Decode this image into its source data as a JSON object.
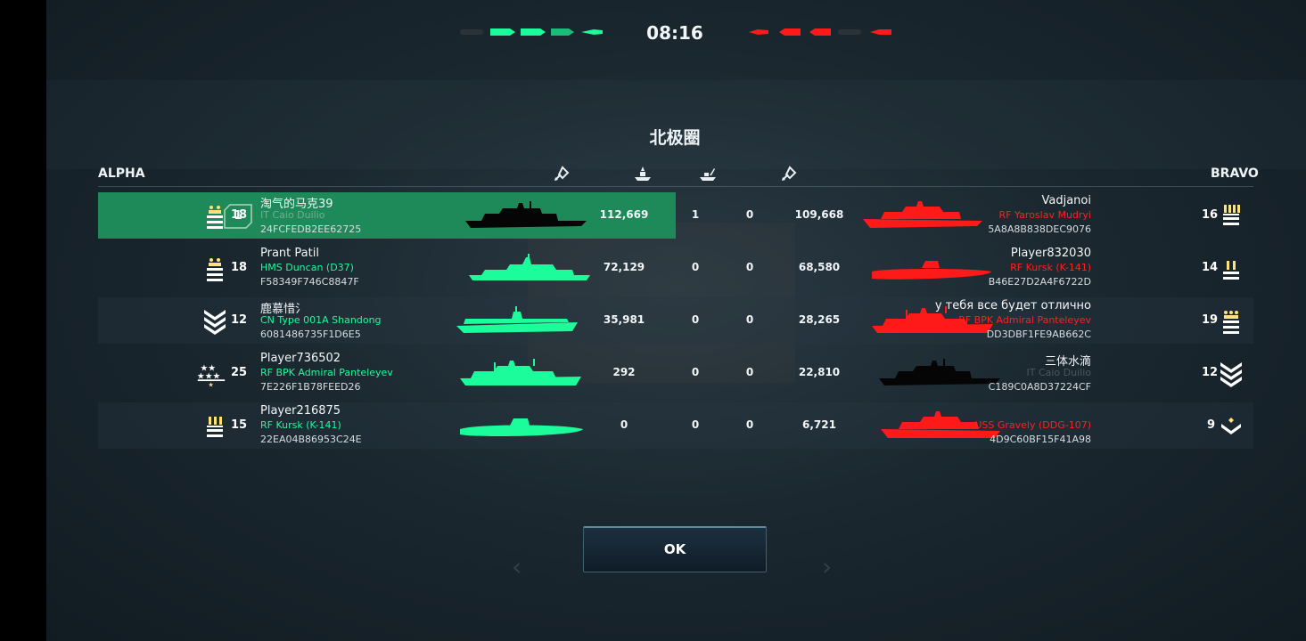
{
  "timer": "08:16",
  "map_name": "北极圈",
  "teams": {
    "alpha": "ALPHA",
    "bravo": "BRAVO"
  },
  "colors": {
    "alpha": "#1dfc9a",
    "bravo": "#ff1a1a",
    "highlight": "#1e8a5a",
    "ship_dark": "#050505"
  },
  "column_icons": [
    "damage-icon",
    "ship-sunk-icon",
    "assist-icon",
    "damage-received-icon"
  ],
  "alpha": [
    {
      "level": "18",
      "rank_icon": "rank-stripes-icon",
      "position": "1",
      "name": "淘气的马克39",
      "ship": "IT Caio Duilio",
      "id": "24FCFEDB2EE62725",
      "damage": "112,669",
      "kills": "1",
      "assists": "0",
      "received": "109,668"
    },
    {
      "level": "18",
      "rank_icon": "rank-stripes-icon",
      "name": "Prant Patil",
      "ship": "HMS Duncan (D37)",
      "id": "F58349F746C8847F",
      "damage": "72,129",
      "kills": "0",
      "assists": "0",
      "received": "68,580"
    },
    {
      "level": "12",
      "rank_icon": "rank-chevrons-icon",
      "name": "鹿慕惜氵",
      "ship": "CN Type 001A Shandong",
      "id": "6081486735F1D6E5",
      "damage": "35,981",
      "kills": "0",
      "assists": "0",
      "received": "28,265"
    },
    {
      "level": "25",
      "rank_icon": "rank-stars-icon",
      "name": "Player736502",
      "ship": "RF BPK Admiral Panteleyev",
      "id": "7E226F1B78FEED26",
      "damage": "292",
      "kills": "0",
      "assists": "0",
      "received": "22,810"
    },
    {
      "level": "15",
      "rank_icon": "rank-stripes-icon",
      "name": "Player216875",
      "ship": "RF Kursk (K-141)",
      "id": "22EA04B86953C24E",
      "damage": "0",
      "kills": "0",
      "assists": "0",
      "received": "6,721"
    }
  ],
  "bravo": [
    {
      "level": "16",
      "rank_icon": "rank-stripes-icon",
      "name": "Vadjanoi",
      "ship": "RF Yaroslav Mudryi",
      "id": "5A8A8B838DEC9076"
    },
    {
      "level": "14",
      "rank_icon": "rank-stripes-icon",
      "name": "Player832030",
      "ship": "RF Kursk (K-141)",
      "id": "B46E27D2A4F6722D"
    },
    {
      "level": "19",
      "rank_icon": "rank-stripes-icon",
      "name": "у тебя все будет отлично",
      "ship": "RF BPK Admiral Panteleyev",
      "id": "DD3DBF1FE9AB662C"
    },
    {
      "level": "12",
      "rank_icon": "rank-chevrons-icon",
      "name": "三体水滴",
      "ship": "IT Caio Duilio",
      "id": "C189C0A8D37224CF"
    },
    {
      "level": "9",
      "rank_icon": "rank-chevrons-icon",
      "name": "",
      "ship": "USS Gravely (DDG-107)",
      "id": "4D9C60BF15F41A98"
    }
  ],
  "ok_label": "OK"
}
